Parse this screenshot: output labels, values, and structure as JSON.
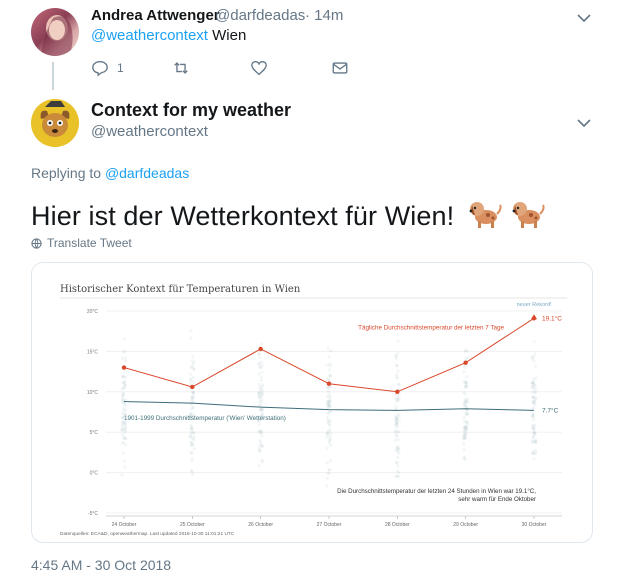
{
  "tweet1": {
    "name": "Andrea Attwenger",
    "handle": "@darfdeadas",
    "time": "· 14m",
    "mention": "@weathercontext",
    "text": "Wien",
    "reply_count": "1"
  },
  "tweet2": {
    "name": "Context for my weather",
    "handle": "@weathercontext",
    "replying_prefix": "Replying to",
    "replying_handle": "@darfdeadas",
    "text": "Hier ist der Wetterkontext für Wien!",
    "translate": "Translate Tweet",
    "timestamp": "4:45 AM - 30 Oct 2018"
  },
  "colors": {
    "link": "#1da1f2",
    "recent": "#d9482b",
    "historic": "#3f6e7a",
    "record": "#7aaac8"
  },
  "chart_data": {
    "type": "line",
    "title": "Historischer Kontext für Temperaturen in Wien",
    "categories": [
      "24 October",
      "25 October",
      "26 October",
      "27 October",
      "28 October",
      "29 October",
      "30 October"
    ],
    "yticks": [
      "20°C",
      "15°C",
      "10°C",
      "5°C",
      "0°C",
      "-5°C"
    ],
    "ylim": [
      -5,
      20
    ],
    "series": [
      {
        "name": "Tägliche Durchschnittstemperatur der letzten 7 Tage",
        "values": [
          13.0,
          10.6,
          15.3,
          11.0,
          10.0,
          13.6,
          19.1
        ]
      },
      {
        "name": "1901-1999 Durchschnittstemperatur ('Wien' Wetterstation)",
        "values": [
          8.8,
          8.6,
          8.1,
          7.8,
          7.7,
          7.9,
          7.7
        ]
      }
    ],
    "record_label": "neuer Rekord!",
    "recent_end_label": "19.1°C",
    "historic_end_label": "7.7°C",
    "annotation_line1": "Die Durchschnittstemperatur der letzten 24 Stunden in Wien war 19.1°C,",
    "annotation_line2": "sehr warm für Ende Oktober",
    "footer": "Datenquellen: ECA&D, openweathermap. Last updated 2018-10-30 11:01:21 UTC"
  }
}
